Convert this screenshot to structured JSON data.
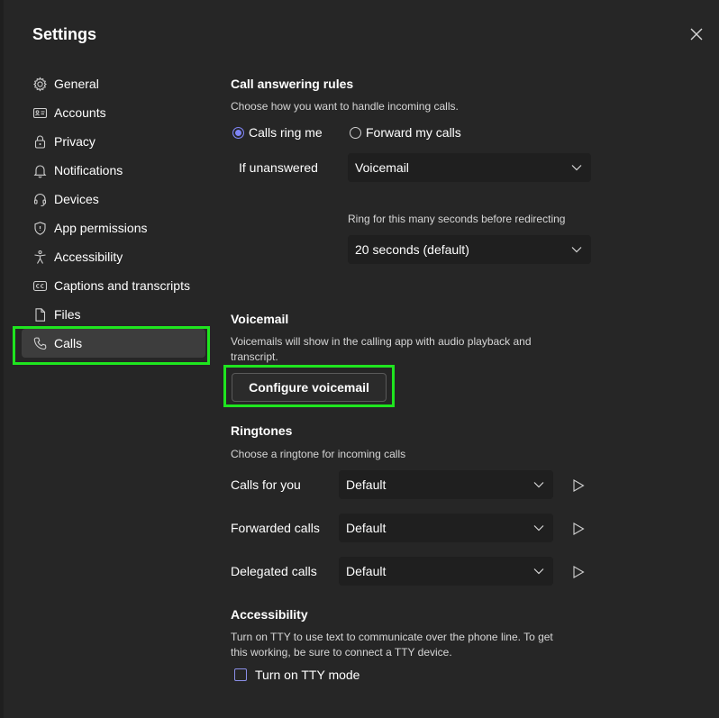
{
  "dialog": {
    "title": "Settings"
  },
  "sidebar": {
    "items": [
      {
        "label": "General",
        "icon": "gear-icon"
      },
      {
        "label": "Accounts",
        "icon": "id-card-icon"
      },
      {
        "label": "Privacy",
        "icon": "lock-icon"
      },
      {
        "label": "Notifications",
        "icon": "bell-icon"
      },
      {
        "label": "Devices",
        "icon": "headset-icon"
      },
      {
        "label": "App permissions",
        "icon": "shield-icon"
      },
      {
        "label": "Accessibility",
        "icon": "accessibility-icon"
      },
      {
        "label": "Captions and transcripts",
        "icon": "cc-icon"
      },
      {
        "label": "Files",
        "icon": "file-icon"
      },
      {
        "label": "Calls",
        "icon": "phone-icon",
        "active": true
      }
    ]
  },
  "call_answering": {
    "title": "Call answering rules",
    "description": "Choose how you want to handle incoming calls.",
    "option_ring": "Calls ring me",
    "option_forward": "Forward my calls",
    "selected": "Calls ring me",
    "if_unanswered_label": "If unanswered",
    "if_unanswered_value": "Voicemail",
    "ring_seconds_label": "Ring for this many seconds before redirecting",
    "ring_seconds_value": "20 seconds (default)"
  },
  "voicemail": {
    "title": "Voicemail",
    "description_line1": "Voicemails will show in the calling app with audio playback and",
    "description_line2": "transcript.",
    "button": "Configure voicemail"
  },
  "ringtones": {
    "title": "Ringtones",
    "description": "Choose a ringtone for incoming calls",
    "rows": [
      {
        "label": "Calls for you",
        "value": "Default"
      },
      {
        "label": "Forwarded calls",
        "value": "Default"
      },
      {
        "label": "Delegated calls",
        "value": "Default"
      }
    ]
  },
  "accessibility": {
    "title": "Accessibility",
    "description_line1": "Turn on TTY to use text to communicate over the phone line. To get",
    "description_line2": "this working, be sure to connect a TTY device.",
    "tty_label": "Turn on TTY mode",
    "tty_checked": false
  },
  "colors": {
    "background": "#262626",
    "accent": "#7f85f5",
    "highlight": "#1fe51f",
    "active_nav": "#3d3d3d",
    "dropdown": "#1f1f1f"
  }
}
